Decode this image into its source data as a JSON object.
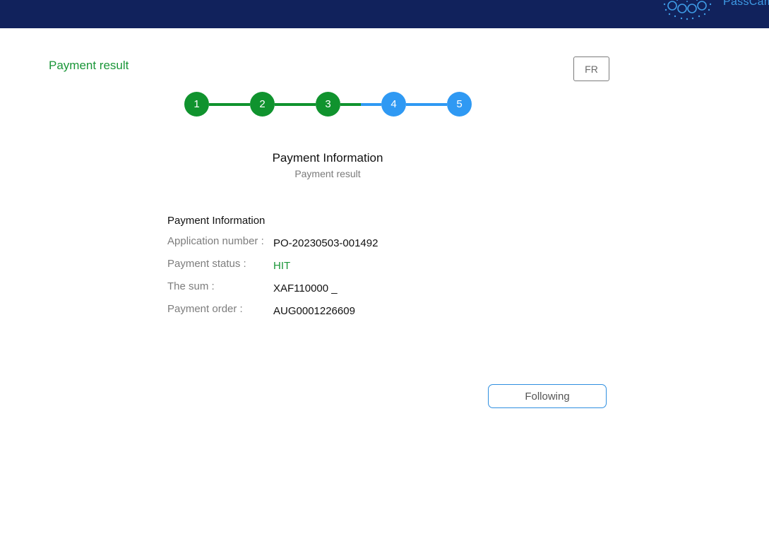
{
  "header": {
    "brand": "PassCam"
  },
  "page": {
    "heading": "Payment result",
    "language_button": "FR"
  },
  "stepper": {
    "steps": [
      "1",
      "2",
      "3",
      "4",
      "5"
    ],
    "completed_steps": 3
  },
  "section": {
    "title": "Payment Information",
    "subtitle": "Payment result"
  },
  "info": {
    "heading": "Payment Information",
    "rows": [
      {
        "label": "Application number :",
        "value": "PO-20230503-001492"
      },
      {
        "label": "Payment status :",
        "value": "HIT"
      },
      {
        "label": "The sum :",
        "value": "XAF110000 _"
      },
      {
        "label": "Payment order :",
        "value": "AUG0001226609"
      }
    ]
  },
  "actions": {
    "next_label": "Following"
  },
  "colors": {
    "header_bg": "#11225c",
    "success": "#10932e",
    "accent": "#2f99f3"
  },
  "icons": {
    "brand_logo": "passcam-logo-icon"
  }
}
